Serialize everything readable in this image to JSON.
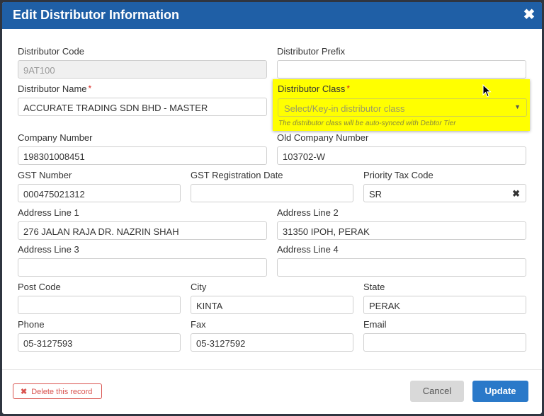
{
  "dialog": {
    "title": "Edit Distributor Information",
    "close_glyph": "✖"
  },
  "form": {
    "distributor_code": {
      "label": "Distributor Code",
      "value": "9AT100"
    },
    "distributor_prefix": {
      "label": "Distributor Prefix",
      "value": ""
    },
    "distributor_name": {
      "label": "Distributor Name",
      "required": "*",
      "value": "ACCURATE TRADING SDN BHD - MASTER"
    },
    "distributor_class": {
      "label": "Distributor Class",
      "required": "*",
      "placeholder": "Select/Key-in distributor class",
      "note": "The distributor class will be auto-synced with Debtor Tier"
    },
    "company_number": {
      "label": "Company Number",
      "value": "198301008451"
    },
    "old_company_number": {
      "label": "Old Company Number",
      "value": "103702-W"
    },
    "gst_number": {
      "label": "GST Number",
      "value": "000475021312"
    },
    "gst_registration_date": {
      "label": "GST Registration Date",
      "value": ""
    },
    "priority_tax_code": {
      "label": "Priority Tax Code",
      "value": "SR",
      "clear_glyph": "✖"
    },
    "address_line_1": {
      "label": "Address Line 1",
      "value": "276 JALAN RAJA DR. NAZRIN SHAH"
    },
    "address_line_2": {
      "label": "Address Line 2",
      "value": "31350 IPOH, PERAK"
    },
    "address_line_3": {
      "label": "Address Line 3",
      "value": ""
    },
    "address_line_4": {
      "label": "Address Line 4",
      "value": ""
    },
    "post_code": {
      "label": "Post Code",
      "value": ""
    },
    "city": {
      "label": "City",
      "value": "KINTA"
    },
    "state": {
      "label": "State",
      "value": "PERAK"
    },
    "phone": {
      "label": "Phone",
      "value": "05-3127593"
    },
    "fax": {
      "label": "Fax",
      "value": "05-3127592"
    },
    "email": {
      "label": "Email",
      "value": ""
    }
  },
  "footer": {
    "delete_label": "Delete this record",
    "delete_icon": "✖",
    "cancel_label": "Cancel",
    "update_label": "Update"
  },
  "colors": {
    "header": "#1f5fa6",
    "highlight": "#ffff00",
    "primary_button": "#2a79c9",
    "danger": "#d9534f",
    "required": "#d9231d"
  }
}
